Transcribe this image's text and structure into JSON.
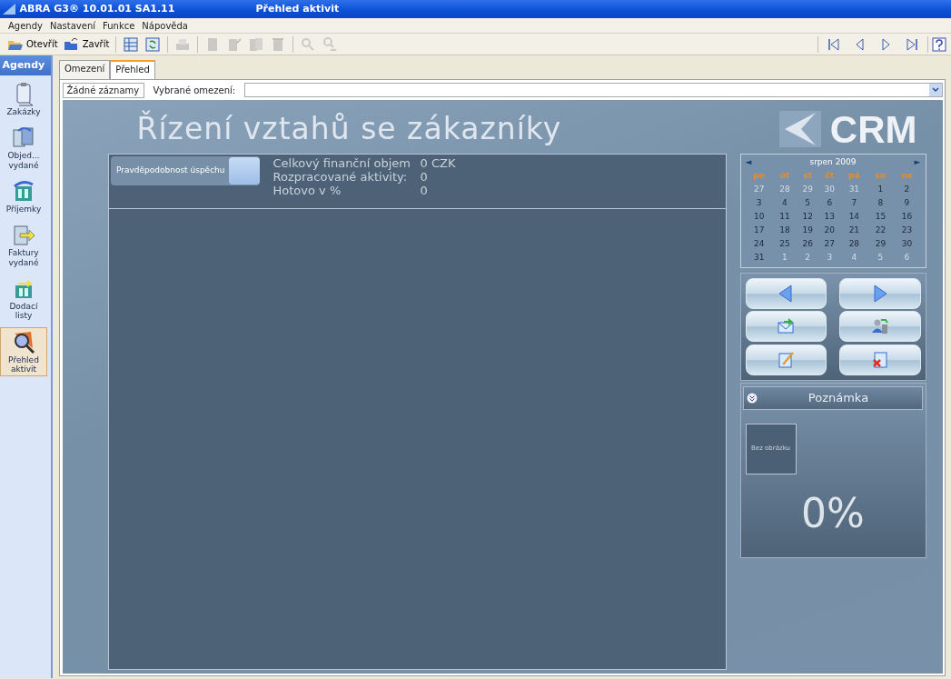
{
  "window": {
    "app": "ABRA G3® 10.01.01 SA1.11",
    "title": "Přehled aktivit"
  },
  "menu": [
    "Agendy",
    "Nastavení",
    "Funkce",
    "Nápověda"
  ],
  "toolbar": [
    {
      "kind": "open",
      "label": "Otevřít",
      "disabled": false
    },
    {
      "kind": "close",
      "label": "Zavřít",
      "disabled": false
    },
    {
      "kind": "sep"
    },
    {
      "kind": "grid",
      "disabled": false
    },
    {
      "kind": "refresh",
      "disabled": false
    },
    {
      "kind": "sep"
    },
    {
      "kind": "print",
      "disabled": true
    },
    {
      "kind": "sep"
    },
    {
      "kind": "new",
      "disabled": true
    },
    {
      "kind": "edit",
      "disabled": true
    },
    {
      "kind": "copy",
      "disabled": true
    },
    {
      "kind": "delete",
      "disabled": true
    },
    {
      "kind": "sep"
    },
    {
      "kind": "find",
      "disabled": true
    },
    {
      "kind": "findnext",
      "disabled": true
    }
  ],
  "navigator": [
    {
      "kind": "first"
    },
    {
      "kind": "prev"
    },
    {
      "kind": "next"
    },
    {
      "kind": "last"
    }
  ],
  "sidebar": {
    "title": "Agendy",
    "items": [
      {
        "label": "Zakázky",
        "selected": false
      },
      {
        "label": "Objed... vydané",
        "selected": false
      },
      {
        "label": "Příjemky",
        "selected": false
      },
      {
        "label": "Faktury vydané",
        "selected": false
      },
      {
        "label": "Dodací listy",
        "selected": false
      },
      {
        "label": "Přehled aktivit",
        "selected": true
      }
    ]
  },
  "tabs": [
    {
      "label": "Omezení",
      "selected": false
    },
    {
      "label": "Přehled",
      "selected": true
    }
  ],
  "filter": {
    "records": "Žádné záznamy",
    "label": "Vybrané omezení:"
  },
  "crm": {
    "heading": "Řízení vztahů se zákazníky",
    "logo": "CRM",
    "probability_button": "Pravděpodobnost úspěchu",
    "stats": [
      {
        "label": "Celkový finanční objem",
        "value": "0 CZK"
      },
      {
        "label": "Rozpracované aktivity:",
        "value": "0"
      },
      {
        "label": "Hotovo v %",
        "value": "0"
      }
    ]
  },
  "calendar": {
    "month": "srpen 2009",
    "prev": "◄",
    "next": "►",
    "weekdays": [
      "po",
      "út",
      "st",
      "čt",
      "pá",
      "so",
      "ne"
    ],
    "weeks": [
      [
        {
          "d": "27",
          "outside": true
        },
        {
          "d": "28",
          "outside": true
        },
        {
          "d": "29",
          "outside": true
        },
        {
          "d": "30",
          "outside": true
        },
        {
          "d": "31",
          "outside": true
        },
        {
          "d": "1",
          "outside": false
        },
        {
          "d": "2",
          "outside": false
        }
      ],
      [
        {
          "d": "3",
          "outside": false
        },
        {
          "d": "4",
          "outside": false
        },
        {
          "d": "5",
          "outside": false
        },
        {
          "d": "6",
          "outside": false
        },
        {
          "d": "7",
          "outside": false
        },
        {
          "d": "8",
          "outside": false
        },
        {
          "d": "9",
          "outside": false
        }
      ],
      [
        {
          "d": "10",
          "outside": false
        },
        {
          "d": "11",
          "outside": false
        },
        {
          "d": "12",
          "outside": false
        },
        {
          "d": "13",
          "outside": false
        },
        {
          "d": "14",
          "outside": false
        },
        {
          "d": "15",
          "outside": false
        },
        {
          "d": "16",
          "outside": false
        }
      ],
      [
        {
          "d": "17",
          "outside": false
        },
        {
          "d": "18",
          "outside": false
        },
        {
          "d": "19",
          "outside": false
        },
        {
          "d": "20",
          "outside": false
        },
        {
          "d": "21",
          "outside": false
        },
        {
          "d": "22",
          "outside": false
        },
        {
          "d": "23",
          "outside": false
        }
      ],
      [
        {
          "d": "24",
          "outside": false
        },
        {
          "d": "25",
          "outside": false
        },
        {
          "d": "26",
          "outside": false
        },
        {
          "d": "27",
          "outside": false
        },
        {
          "d": "28",
          "outside": false
        },
        {
          "d": "29",
          "outside": false
        },
        {
          "d": "30",
          "outside": false
        }
      ],
      [
        {
          "d": "31",
          "outside": false
        },
        {
          "d": "1",
          "outside": true
        },
        {
          "d": "2",
          "outside": true
        },
        {
          "d": "3",
          "outside": true
        },
        {
          "d": "4",
          "outside": true
        },
        {
          "d": "5",
          "outside": true
        },
        {
          "d": "6",
          "outside": true
        }
      ]
    ]
  },
  "actions": [
    {
      "kind": "prev"
    },
    {
      "kind": "next"
    },
    {
      "kind": "mail"
    },
    {
      "kind": "users"
    },
    {
      "kind": "edit"
    },
    {
      "kind": "delete"
    }
  ],
  "note": {
    "title": "Poznámka",
    "image_placeholder": "Bez obrázku",
    "percent": "0%"
  }
}
